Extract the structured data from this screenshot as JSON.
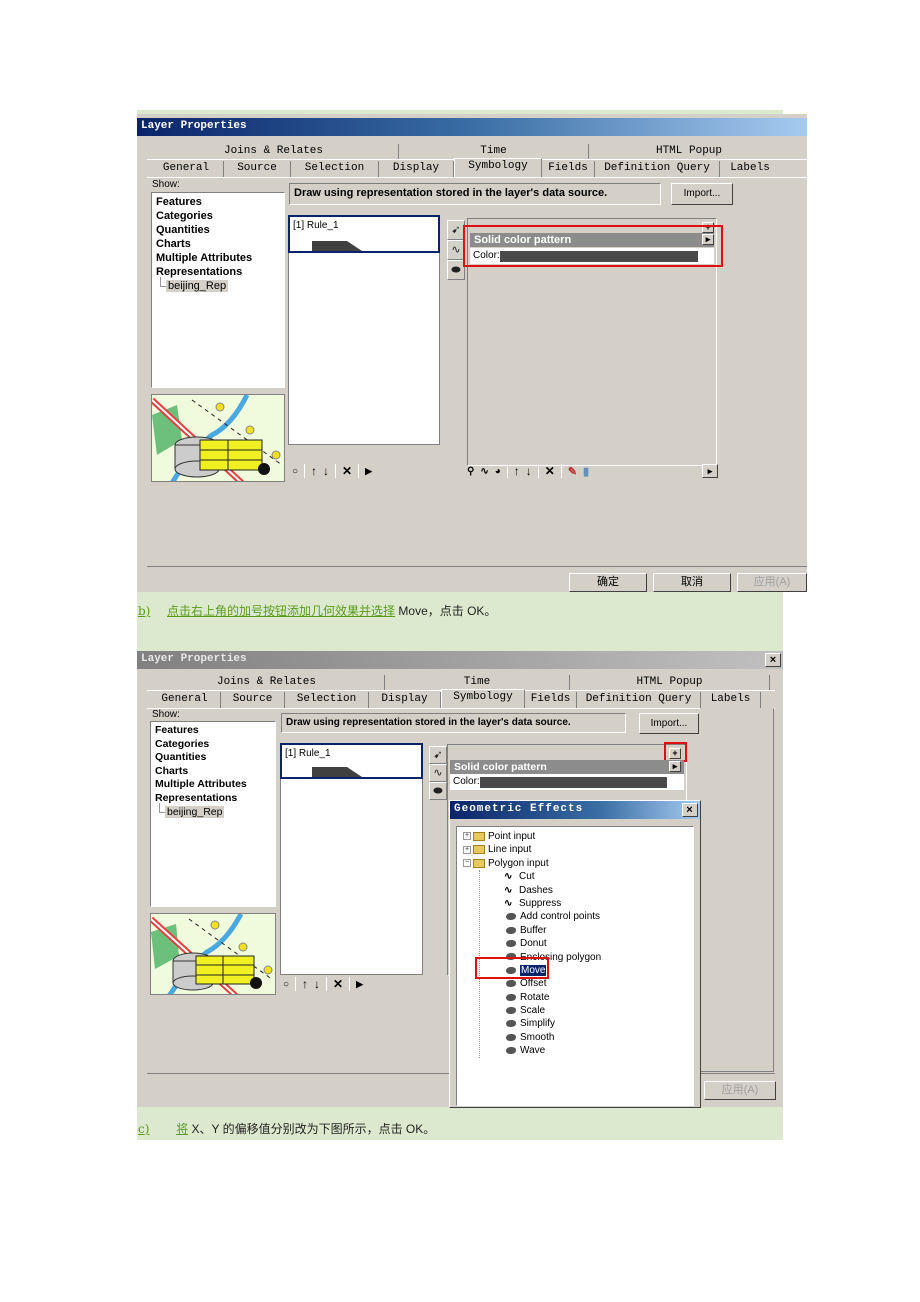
{
  "screenshot1": {
    "window_title": "Layer Properties",
    "tabs_row1": [
      "Joins & Relates",
      "Time",
      "HTML Popup"
    ],
    "tabs_row2": [
      "General",
      "Source",
      "Selection",
      "Display",
      "Symbology",
      "Fields",
      "Definition Query",
      "Labels"
    ],
    "active_tab": "Symbology",
    "show_label": "Show:",
    "show_items": [
      "Features",
      "Categories",
      "Quantities",
      "Charts",
      "Multiple Attributes",
      "Representations"
    ],
    "show_subitem": "beijing_Rep",
    "draw_text": "Draw using representation stored in the layer's data source.",
    "import_label": "Import...",
    "rule": "[1] Rule_1",
    "effect_header": "Solid color pattern",
    "color_label": "Color:",
    "color_value": "#4a4a4a",
    "rule_toolbar": [
      "◦",
      "↑",
      "↓",
      "×",
      "▸"
    ],
    "effect_toolbar": [
      "↑",
      "↓",
      "×"
    ],
    "ok_label": "确定",
    "cancel_label": "取消",
    "apply_label": "应用(A)"
  },
  "caption_b": {
    "prefix": "b)",
    "underlined": "点击右上角的加号按钮添加几何效果并选择",
    "rest": "Move，点击 OK。"
  },
  "screenshot2": {
    "window_title": "Layer Properties",
    "close_label": "×",
    "tabs_row1": [
      "Joins & Relates",
      "Time",
      "HTML Popup"
    ],
    "tabs_row2": [
      "General",
      "Source",
      "Selection",
      "Display",
      "Symbology",
      "Fields",
      "Definition Query",
      "Labels"
    ],
    "active_tab": "Symbology",
    "show_label": "Show:",
    "show_items": [
      "Features",
      "Categories",
      "Quantities",
      "Charts",
      "Multiple Attributes",
      "Representations"
    ],
    "show_subitem": "beijing_Rep",
    "draw_text": "Draw using representation stored in the layer's data source.",
    "import_label": "Import...",
    "rule": "[1] Rule_1",
    "add_label": "+",
    "effect_header": "Solid color pattern",
    "color_label": "Color:",
    "rule_toolbar": [
      "◦",
      "↑",
      "↓",
      "×",
      "▸"
    ],
    "apply_label": "应用(A)",
    "geo_dialog": {
      "title": "Geometric Effects",
      "close_label": "×",
      "groups": [
        {
          "label": "Point input",
          "expanded": false
        },
        {
          "label": "Line input",
          "expanded": false
        },
        {
          "label": "Polygon input",
          "expanded": true
        }
      ],
      "line_effects": [
        "Cut",
        "Dashes",
        "Suppress"
      ],
      "polygon_effects": [
        "Add control points",
        "Buffer",
        "Donut",
        "Enclosing polygon",
        "Move",
        "Offset",
        "Rotate",
        "Scale",
        "Simplify",
        "Smooth",
        "Wave"
      ],
      "selected": "Move"
    }
  },
  "caption_c": {
    "prefix": "c)",
    "underlined": "将",
    "rest": "X、Y 的偏移值分别改为下图所示，点击 OK。"
  }
}
